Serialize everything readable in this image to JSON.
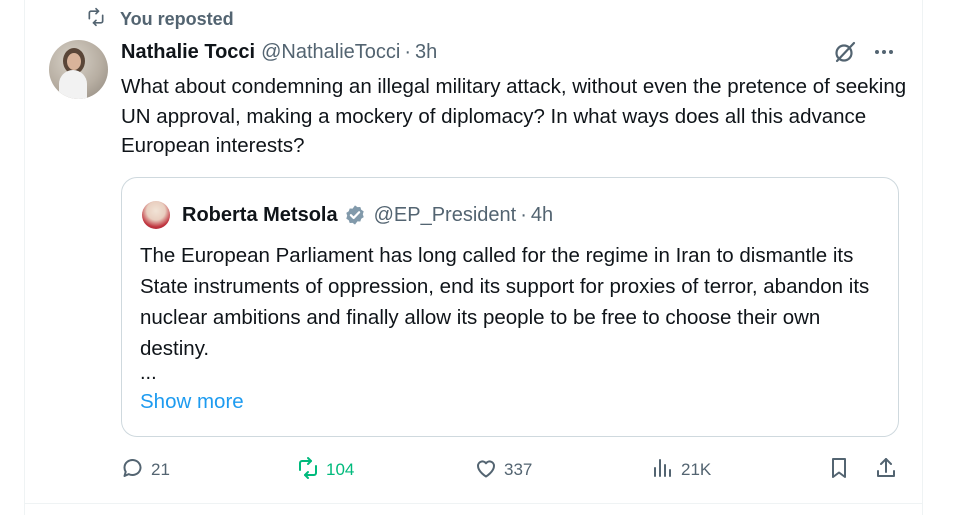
{
  "social_context": {
    "text": "You reposted"
  },
  "tweet": {
    "author_name": "Nathalie Tocci",
    "author_handle": "@NathalieTocci",
    "separator": "·",
    "time": "3h",
    "text": "What about condemning an illegal military attack, without even the pretence of seeking UN approval, making a mockery of diplomacy? In what ways does all this advance European interests?"
  },
  "quote": {
    "author_name": "Roberta Metsola",
    "author_handle": "@EP_President",
    "separator": "·",
    "time": "4h",
    "text": "The European Parliament has long called for the regime in Iran to dismantle its State instruments of oppression, end its support for proxies of terror, abandon its nuclear ambitions and finally allow its people to be free to choose their own destiny.",
    "ellipsis": "...",
    "show_more": "Show more"
  },
  "actions": {
    "replies": "21",
    "reposts": "104",
    "likes": "337",
    "views": "21K"
  },
  "icons": [
    "repost-icon",
    "grok-icon",
    "more-icon",
    "verified-icon",
    "reply-icon",
    "like-icon",
    "views-icon",
    "bookmark-icon",
    "share-icon"
  ],
  "colors": {
    "accent": "#1d9bf0",
    "repost_active": "#00ba7c",
    "muted": "#536471",
    "verified": "#829aab"
  }
}
